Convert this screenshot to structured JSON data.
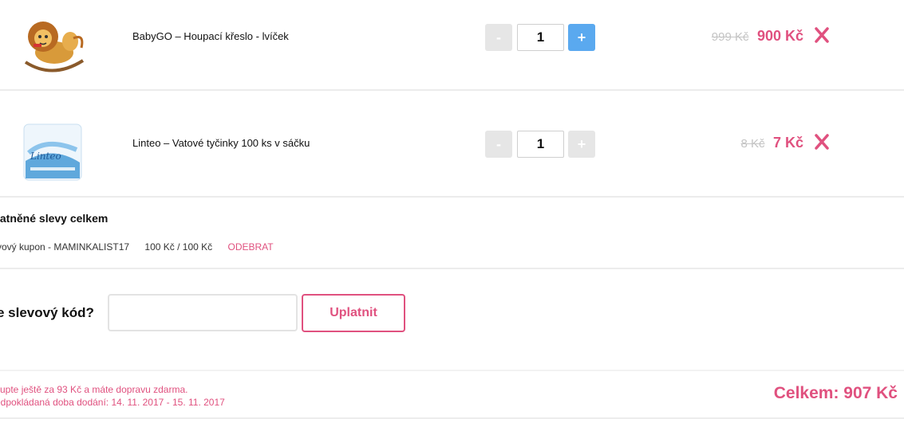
{
  "cart": {
    "items": [
      {
        "name": "BabyGO – Houpací křeslo - lvíček",
        "quantity": "1",
        "old_price": "999 Kč",
        "price": "900 Kč",
        "minus_label": "-",
        "plus_label": "+",
        "image_icon": "rocking-lion-toy-image",
        "plus_state": "active"
      },
      {
        "name": "Linteo – Vatové tyčinky 100 ks v sáčku",
        "quantity": "1",
        "old_price": "8 Kč",
        "price": "7 Kč",
        "minus_label": "-",
        "plus_label": "+",
        "image_icon": "cotton-swabs-bag-image",
        "plus_state": "disabled"
      }
    ],
    "remove_icon": "close-x-icon"
  },
  "discounts": {
    "title": "latněné slevy celkem",
    "coupon_label": "vový kupon - MAMINKALIST17",
    "coupon_amount": "100 Kč / 100 Kč",
    "remove_label": "ODEBRAT"
  },
  "coupon_form": {
    "question": "e slevový kód?",
    "input_value": "",
    "button_label": "Uplatnit"
  },
  "footer": {
    "shipping_note": "kupte ještě za 93 Kč a máte dopravu zdarma.",
    "delivery_note": "edpokládaná doba dodání: 14. 11. 2017 - 15. 11. 2017",
    "total": "Celkem: 907 Kč"
  },
  "colors": {
    "accent": "#e0517f",
    "plus_active": "#5aa9ef",
    "disabled": "#e6e6e6",
    "old_price": "#c4c4c4"
  }
}
